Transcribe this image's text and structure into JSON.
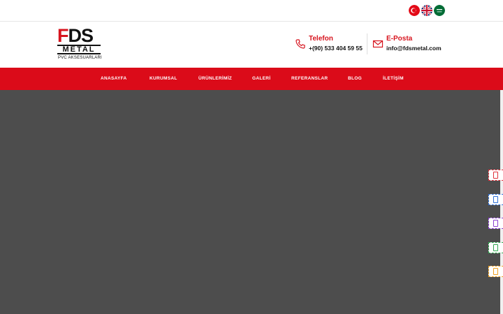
{
  "languages": [
    {
      "code": "tr",
      "icon": "turkey-flag-icon"
    },
    {
      "code": "en",
      "icon": "uk-flag-icon"
    },
    {
      "code": "ar",
      "icon": "saudi-flag-icon"
    }
  ],
  "logo": {
    "line1_first": "F",
    "line1_rest": "DS",
    "line2": "METAL",
    "tagline": "PVC AKSESUARLARI"
  },
  "contact": {
    "phone_title": "Telefon",
    "phone_value": "+(90) 533 404 59 55",
    "email_title": "E-Posta",
    "email_value": "info@fdsmetal.com"
  },
  "nav": {
    "items": [
      "ANASAYFA",
      "KURUMSAL",
      "ÜRÜNLERİMİZ",
      "GALERİ",
      "REFERANSLAR",
      "BLOG",
      "İLETİŞİM"
    ]
  },
  "colors": {
    "brand_red": "#db0b19",
    "hero_bg": "#4d4d4d"
  },
  "side_buttons": [
    {
      "icon": "side-button-icon",
      "color": "#e0303a"
    },
    {
      "icon": "side-button-icon",
      "color": "#2d6fd8"
    },
    {
      "icon": "side-button-icon",
      "color": "#8a3fd1"
    },
    {
      "icon": "side-button-icon",
      "color": "#2fa84f"
    },
    {
      "icon": "side-button-icon",
      "color": "#f0a020"
    }
  ]
}
